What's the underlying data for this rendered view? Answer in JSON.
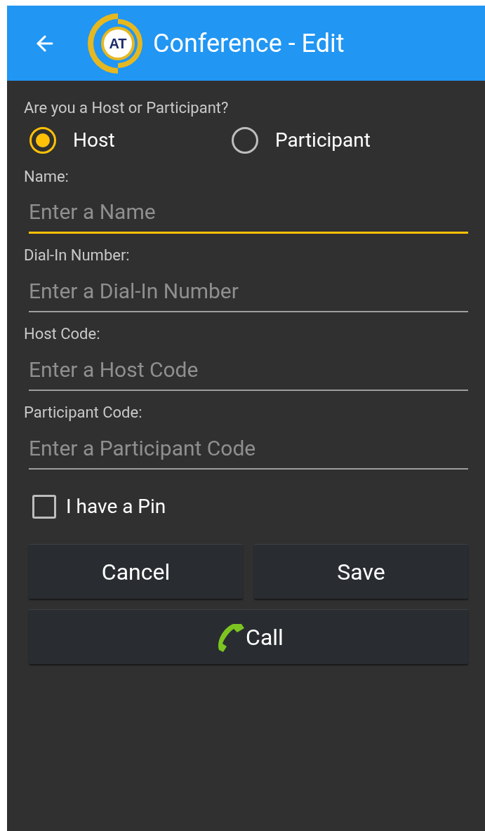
{
  "app_bar": {
    "logo_text": "AT",
    "title": "Conference - Edit"
  },
  "role": {
    "label": "Are you a Host or Participant?",
    "options": [
      {
        "label": "Host",
        "selected": true
      },
      {
        "label": "Participant",
        "selected": false
      }
    ]
  },
  "fields": [
    {
      "label": "Name:",
      "placeholder": "Enter a Name",
      "focused": true
    },
    {
      "label": "Dial-In Number:",
      "placeholder": "Enter a Dial-In Number",
      "focused": false
    },
    {
      "label": "Host Code:",
      "placeholder": "Enter a Host Code",
      "focused": false
    },
    {
      "label": "Participant Code:",
      "placeholder": "Enter a Participant Code",
      "focused": false
    }
  ],
  "pin": {
    "label": "I have a Pin",
    "checked": false
  },
  "buttons": [
    "Cancel",
    "Save"
  ],
  "call_button": "Call"
}
